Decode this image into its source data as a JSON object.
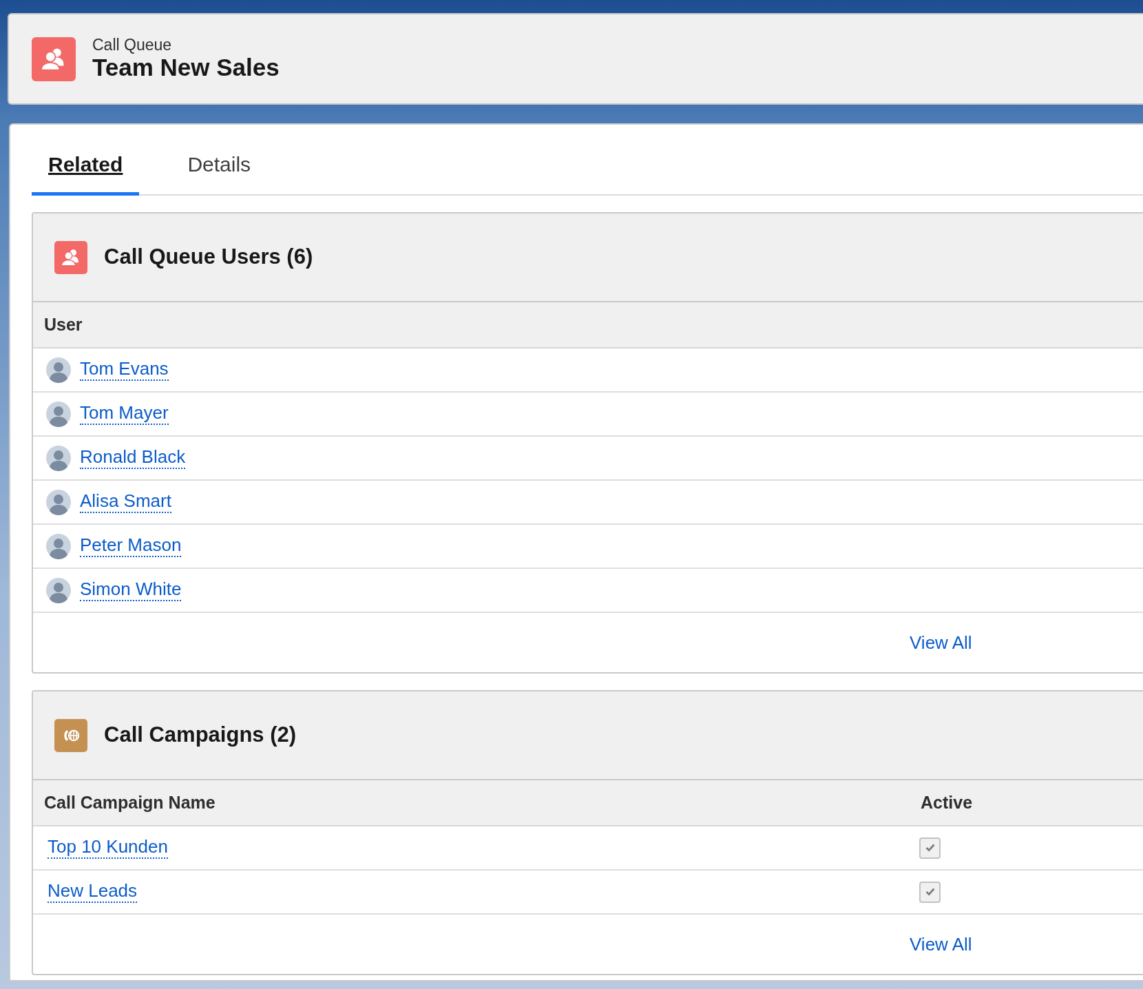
{
  "header": {
    "object_type": "Call Queue",
    "title": "Team New Sales"
  },
  "tabs": [
    {
      "label": "Related",
      "selected": true
    },
    {
      "label": "Details",
      "selected": false
    }
  ],
  "related_lists": [
    {
      "kind": "users",
      "title": "Call Queue Users (6)",
      "columns": [
        "User"
      ],
      "rows": [
        {
          "cells": [
            "Tom Evans"
          ]
        },
        {
          "cells": [
            "Tom Mayer"
          ]
        },
        {
          "cells": [
            "Ronald Black"
          ]
        },
        {
          "cells": [
            "Alisa Smart"
          ]
        },
        {
          "cells": [
            "Peter Mason"
          ]
        },
        {
          "cells": [
            "Simon White"
          ]
        }
      ],
      "footer_link": "View All"
    },
    {
      "kind": "campaigns",
      "title": "Call Campaigns (2)",
      "columns": [
        "Call Campaign Name",
        "Active"
      ],
      "rows": [
        {
          "cells": [
            "Top 10 Kunden"
          ],
          "checked": true
        },
        {
          "cells": [
            "New Leads"
          ],
          "checked": true
        }
      ],
      "footer_link": "View All"
    }
  ]
}
